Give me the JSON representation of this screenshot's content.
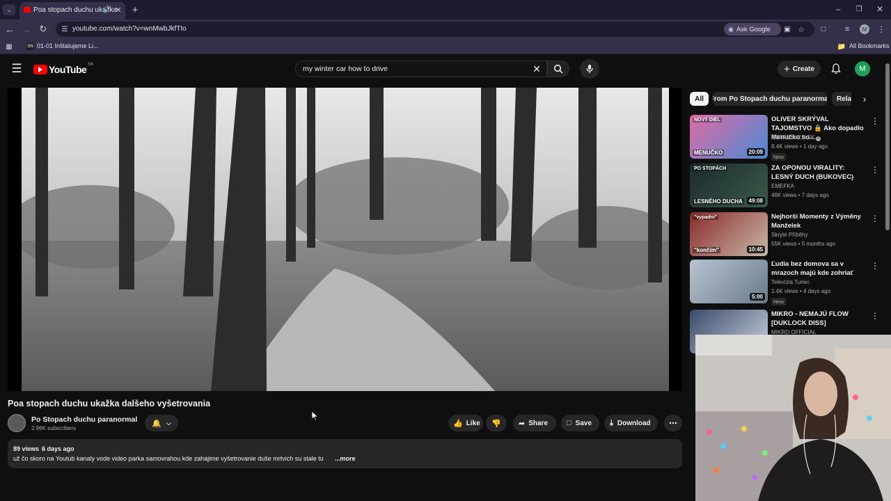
{
  "browser": {
    "tab_title": "Poa stopach duchu ukažka",
    "url": "youtube.com/watch?v=wnMwbJkfTIo",
    "ask_google": "Ask Google",
    "bookmark_item": "01-01 Inštalujeme Li...",
    "bookmark_folder_icon_text": "SN",
    "all_bookmarks": "All Bookmarks",
    "profile_initial": "M"
  },
  "youtube": {
    "logo_text": "YouTube",
    "logo_region": "SK",
    "search_value": "my winter car how to drive",
    "create_label": "Create",
    "avatar_initial": "M"
  },
  "video": {
    "title": "Poa stopach duchu ukažka dalšeho vyšetrovania",
    "channel_name": "Po Stopach duchu paranormal",
    "subscribers": "2.96K subscribers",
    "like_label": "Like",
    "share_label": "Share",
    "save_label": "Save",
    "download_label": "Download",
    "views": "89 views",
    "age": "6 days ago",
    "description": "už čo skoro na Youtub kanaly vode video parka samovrahou kde zahajime vyšetrovanie duše mrtvich su stale tu",
    "more_label": "...more"
  },
  "filters": {
    "all": "All",
    "from_channel": "From Po Stopach duchu paranormal",
    "related": "Related"
  },
  "recommendations": [
    {
      "title": "OLIVER SKRÝVAL TAJOMSTVO 🔒 Ako dopadlo Menučko so ...",
      "channel": "REFRESHER SK",
      "verified": true,
      "views": "8.4K views",
      "age": "1 day ago",
      "duration": "20:09",
      "badge": "New",
      "thumb_text": "NOVÝ DIEL",
      "thumb_text2": "MENUČKO"
    },
    {
      "title": "ZA OPONOU VIRALITY: LESNÝ DUCH (BUKOVEC)",
      "channel": "EMEFKA",
      "verified": false,
      "views": "46K views",
      "age": "7 days ago",
      "duration": "49:08",
      "badge": "",
      "thumb_text": "PO STOPÁCH",
      "thumb_text2": "LESNÉHO DUCHA"
    },
    {
      "title": "Nejhorší Momenty z Výměny Manželek",
      "channel": "Skryté Příběhy",
      "verified": false,
      "views": "55K views",
      "age": "5 months ago",
      "duration": "10:45",
      "badge": "",
      "thumb_text": "\"vypadni\"",
      "thumb_text2": "\"končím\""
    },
    {
      "title": "Ľudia bez domova sa v mrazoch majú kde zohriať",
      "channel": "Televízia Turiec",
      "verified": false,
      "views": "1.4K views",
      "age": "4 days ago",
      "duration": "5:00",
      "badge": "New",
      "thumb_text": "",
      "thumb_text2": ""
    },
    {
      "title": "MIKRO - NEMAJÚ FLOW [DUKLOCK DISS]",
      "channel": "MIKRO OFFICIAL",
      "verified": false,
      "views": "",
      "age": "",
      "duration": "",
      "badge": "",
      "thumb_text": "",
      "thumb_text2": ""
    }
  ],
  "colors": {
    "browser_dark": "#1f1b2e",
    "browser_mid": "#35304a",
    "yt_bg": "#0f0f0f",
    "yt_red": "#ff0000",
    "avatar_green": "#1e9e5a"
  }
}
